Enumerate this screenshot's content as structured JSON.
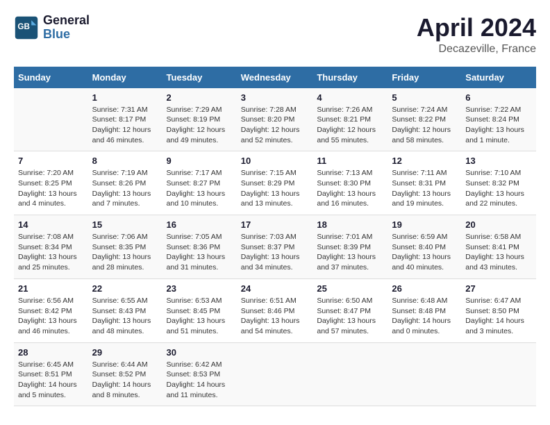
{
  "header": {
    "logo_line1": "General",
    "logo_line2": "Blue",
    "month": "April 2024",
    "location": "Decazeville, France"
  },
  "days_of_week": [
    "Sunday",
    "Monday",
    "Tuesday",
    "Wednesday",
    "Thursday",
    "Friday",
    "Saturday"
  ],
  "weeks": [
    [
      {
        "day": "",
        "info": ""
      },
      {
        "day": "1",
        "info": "Sunrise: 7:31 AM\nSunset: 8:17 PM\nDaylight: 12 hours\nand 46 minutes."
      },
      {
        "day": "2",
        "info": "Sunrise: 7:29 AM\nSunset: 8:19 PM\nDaylight: 12 hours\nand 49 minutes."
      },
      {
        "day": "3",
        "info": "Sunrise: 7:28 AM\nSunset: 8:20 PM\nDaylight: 12 hours\nand 52 minutes."
      },
      {
        "day": "4",
        "info": "Sunrise: 7:26 AM\nSunset: 8:21 PM\nDaylight: 12 hours\nand 55 minutes."
      },
      {
        "day": "5",
        "info": "Sunrise: 7:24 AM\nSunset: 8:22 PM\nDaylight: 12 hours\nand 58 minutes."
      },
      {
        "day": "6",
        "info": "Sunrise: 7:22 AM\nSunset: 8:24 PM\nDaylight: 13 hours\nand 1 minute."
      }
    ],
    [
      {
        "day": "7",
        "info": "Sunrise: 7:20 AM\nSunset: 8:25 PM\nDaylight: 13 hours\nand 4 minutes."
      },
      {
        "day": "8",
        "info": "Sunrise: 7:19 AM\nSunset: 8:26 PM\nDaylight: 13 hours\nand 7 minutes."
      },
      {
        "day": "9",
        "info": "Sunrise: 7:17 AM\nSunset: 8:27 PM\nDaylight: 13 hours\nand 10 minutes."
      },
      {
        "day": "10",
        "info": "Sunrise: 7:15 AM\nSunset: 8:29 PM\nDaylight: 13 hours\nand 13 minutes."
      },
      {
        "day": "11",
        "info": "Sunrise: 7:13 AM\nSunset: 8:30 PM\nDaylight: 13 hours\nand 16 minutes."
      },
      {
        "day": "12",
        "info": "Sunrise: 7:11 AM\nSunset: 8:31 PM\nDaylight: 13 hours\nand 19 minutes."
      },
      {
        "day": "13",
        "info": "Sunrise: 7:10 AM\nSunset: 8:32 PM\nDaylight: 13 hours\nand 22 minutes."
      }
    ],
    [
      {
        "day": "14",
        "info": "Sunrise: 7:08 AM\nSunset: 8:34 PM\nDaylight: 13 hours\nand 25 minutes."
      },
      {
        "day": "15",
        "info": "Sunrise: 7:06 AM\nSunset: 8:35 PM\nDaylight: 13 hours\nand 28 minutes."
      },
      {
        "day": "16",
        "info": "Sunrise: 7:05 AM\nSunset: 8:36 PM\nDaylight: 13 hours\nand 31 minutes."
      },
      {
        "day": "17",
        "info": "Sunrise: 7:03 AM\nSunset: 8:37 PM\nDaylight: 13 hours\nand 34 minutes."
      },
      {
        "day": "18",
        "info": "Sunrise: 7:01 AM\nSunset: 8:39 PM\nDaylight: 13 hours\nand 37 minutes."
      },
      {
        "day": "19",
        "info": "Sunrise: 6:59 AM\nSunset: 8:40 PM\nDaylight: 13 hours\nand 40 minutes."
      },
      {
        "day": "20",
        "info": "Sunrise: 6:58 AM\nSunset: 8:41 PM\nDaylight: 13 hours\nand 43 minutes."
      }
    ],
    [
      {
        "day": "21",
        "info": "Sunrise: 6:56 AM\nSunset: 8:42 PM\nDaylight: 13 hours\nand 46 minutes."
      },
      {
        "day": "22",
        "info": "Sunrise: 6:55 AM\nSunset: 8:43 PM\nDaylight: 13 hours\nand 48 minutes."
      },
      {
        "day": "23",
        "info": "Sunrise: 6:53 AM\nSunset: 8:45 PM\nDaylight: 13 hours\nand 51 minutes."
      },
      {
        "day": "24",
        "info": "Sunrise: 6:51 AM\nSunset: 8:46 PM\nDaylight: 13 hours\nand 54 minutes."
      },
      {
        "day": "25",
        "info": "Sunrise: 6:50 AM\nSunset: 8:47 PM\nDaylight: 13 hours\nand 57 minutes."
      },
      {
        "day": "26",
        "info": "Sunrise: 6:48 AM\nSunset: 8:48 PM\nDaylight: 14 hours\nand 0 minutes."
      },
      {
        "day": "27",
        "info": "Sunrise: 6:47 AM\nSunset: 8:50 PM\nDaylight: 14 hours\nand 3 minutes."
      }
    ],
    [
      {
        "day": "28",
        "info": "Sunrise: 6:45 AM\nSunset: 8:51 PM\nDaylight: 14 hours\nand 5 minutes."
      },
      {
        "day": "29",
        "info": "Sunrise: 6:44 AM\nSunset: 8:52 PM\nDaylight: 14 hours\nand 8 minutes."
      },
      {
        "day": "30",
        "info": "Sunrise: 6:42 AM\nSunset: 8:53 PM\nDaylight: 14 hours\nand 11 minutes."
      },
      {
        "day": "",
        "info": ""
      },
      {
        "day": "",
        "info": ""
      },
      {
        "day": "",
        "info": ""
      },
      {
        "day": "",
        "info": ""
      }
    ]
  ]
}
